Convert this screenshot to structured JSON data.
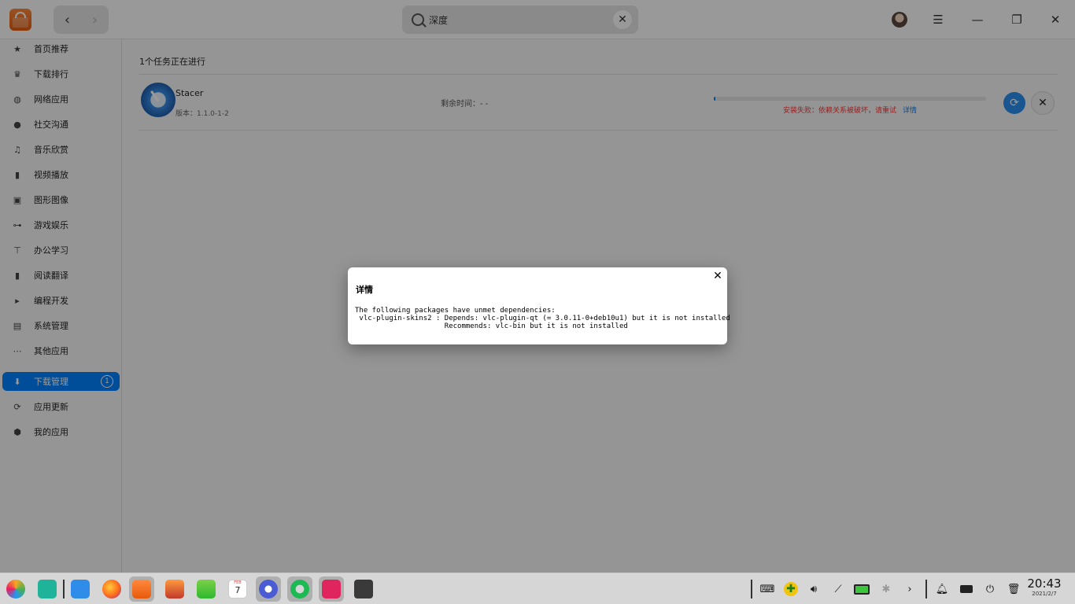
{
  "header": {
    "search_value": "深度",
    "back_icon": "chevron-left-icon",
    "forward_icon": "chevron-right-icon"
  },
  "sidebar": {
    "items": [
      {
        "label": "首页推荐",
        "icon": "star-icon"
      },
      {
        "label": "下载排行",
        "icon": "crown-icon"
      },
      {
        "label": "网络应用",
        "icon": "globe-icon"
      },
      {
        "label": "社交沟通",
        "icon": "chat-icon"
      },
      {
        "label": "音乐欣赏",
        "icon": "music-icon"
      },
      {
        "label": "视频播放",
        "icon": "film-icon"
      },
      {
        "label": "图形图像",
        "icon": "image-icon"
      },
      {
        "label": "游戏娱乐",
        "icon": "gamepad-icon"
      },
      {
        "label": "办公学习",
        "icon": "presentation-icon"
      },
      {
        "label": "阅读翻译",
        "icon": "book-icon"
      },
      {
        "label": "编程开发",
        "icon": "terminal-icon"
      },
      {
        "label": "系统管理",
        "icon": "system-icon"
      },
      {
        "label": "其他应用",
        "icon": "more-icon"
      }
    ],
    "bottom_items": [
      {
        "label": "下载管理",
        "icon": "download-icon",
        "badge": "1",
        "active": true
      },
      {
        "label": "应用更新",
        "icon": "refresh-icon"
      },
      {
        "label": "我的应用",
        "icon": "box-icon"
      }
    ]
  },
  "main": {
    "task_heading": "1个任务正在进行",
    "task": {
      "name": "Stacer",
      "version": "版本：1.1.0-1-2",
      "remaining": "剩余时间：- -",
      "progress": 0.005,
      "error": "安装失败：依赖关系被破坏，请重试",
      "details_link": "详情"
    }
  },
  "dialog": {
    "title": "详情",
    "body": "The following packages have unmet dependencies:\n vlc-plugin-skins2 : Depends: vlc-plugin-qt (= 3.0.11-0+deb10u1) but it is not installed\n                     Recommends: vlc-bin but it is not installed"
  },
  "taskbar": {
    "time": "20:43",
    "date": "2021/2/7",
    "calendar_month": "FEB",
    "calendar_day": "7"
  },
  "colors": {
    "accent": "#0081ff",
    "error": "#ff3636"
  }
}
